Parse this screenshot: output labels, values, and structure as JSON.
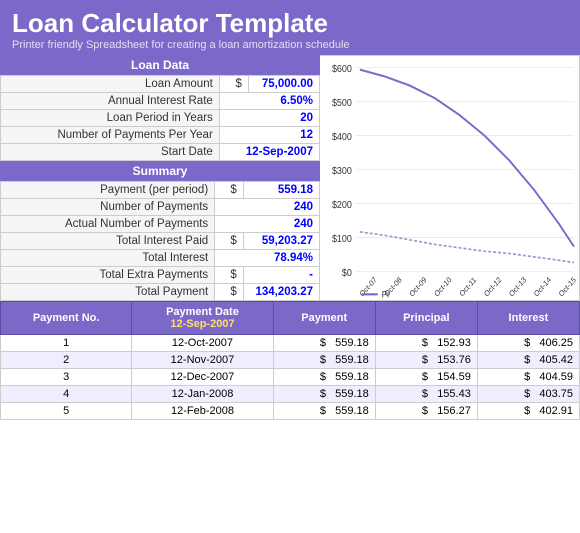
{
  "header": {
    "title": "Loan Calculator Template",
    "subtitle": "Printer friendly Spreadsheet for creating a loan amortization schedule"
  },
  "loan_data": {
    "section_title": "Loan Data",
    "fields": [
      {
        "label": "Loan Amount",
        "dollar": "$",
        "value": "75,000.00"
      },
      {
        "label": "Annual Interest Rate",
        "dollar": "",
        "value": "6.50%"
      },
      {
        "label": "Loan Period in Years",
        "dollar": "",
        "value": "20"
      },
      {
        "label": "Number of Payments Per Year",
        "dollar": "",
        "value": "12"
      },
      {
        "label": "Start Date",
        "dollar": "",
        "value": "12-Sep-2007"
      }
    ]
  },
  "summary": {
    "section_title": "Summary",
    "fields": [
      {
        "label": "Payment (per period)",
        "dollar": "$",
        "value": "559.18"
      },
      {
        "label": "Number of Payments",
        "dollar": "",
        "value": "240"
      },
      {
        "label": "Actual Number of Payments",
        "dollar": "",
        "value": "240"
      },
      {
        "label": "Total Interest Paid",
        "dollar": "$",
        "value": "59,203.27"
      },
      {
        "label": "Total Interest",
        "dollar": "",
        "value": "78.94%"
      },
      {
        "label": "Total Extra Payments",
        "dollar": "$",
        "value": "-"
      },
      {
        "label": "Total Payment",
        "dollar": "$",
        "value": "134,203.27"
      }
    ]
  },
  "chart": {
    "y_labels": [
      "$600",
      "$500",
      "$400",
      "$300",
      "$200",
      "$100",
      "$0"
    ],
    "x_labels": [
      "Oct-07",
      "Oct-08",
      "Oct-09",
      "Oct-10",
      "Oct-11",
      "Oct-12",
      "Oct-13",
      "Oct-14",
      "Oct-15"
    ],
    "legend": "Pr"
  },
  "payment_table": {
    "headers": [
      "Payment No.",
      "Payment Date",
      "Payment",
      "Principal",
      "Interest"
    ],
    "sub_header": "12-Sep-2007",
    "rows": [
      {
        "no": "1",
        "date": "12-Oct-2007",
        "payment_d": "$",
        "payment": "559.18",
        "principal_d": "$",
        "principal": "152.93",
        "interest_d": "$",
        "interest": "406.25"
      },
      {
        "no": "2",
        "date": "12-Nov-2007",
        "payment_d": "$",
        "payment": "559.18",
        "principal_d": "$",
        "principal": "153.76",
        "interest_d": "$",
        "interest": "405.42"
      },
      {
        "no": "3",
        "date": "12-Dec-2007",
        "payment_d": "$",
        "payment": "559.18",
        "principal_d": "$",
        "principal": "154.59",
        "interest_d": "$",
        "interest": "404.59"
      },
      {
        "no": "4",
        "date": "12-Jan-2008",
        "payment_d": "$",
        "payment": "559.18",
        "principal_d": "$",
        "principal": "155.43",
        "interest_d": "$",
        "interest": "403.75"
      },
      {
        "no": "5",
        "date": "12-Feb-2008",
        "payment_d": "$",
        "payment": "559.18",
        "principal_d": "$",
        "principal": "156.27",
        "interest_d": "$",
        "interest": "402.91"
      }
    ]
  }
}
